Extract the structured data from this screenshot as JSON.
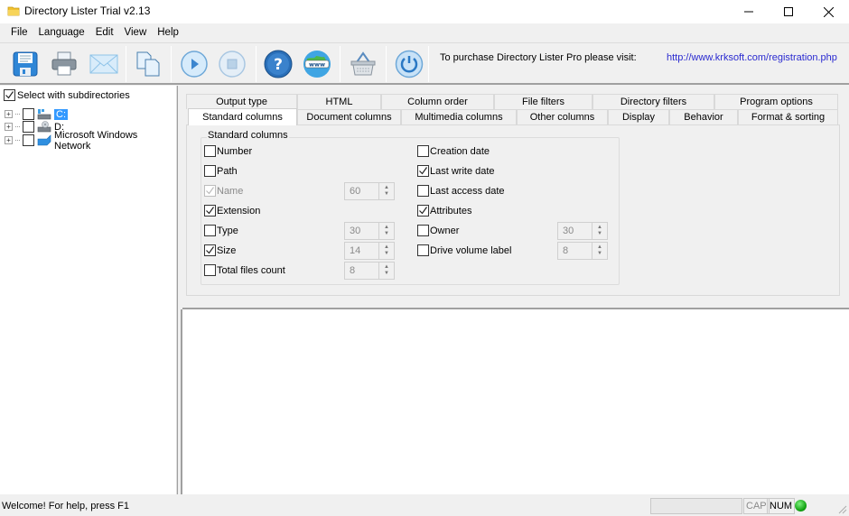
{
  "window": {
    "title": "Directory Lister Trial v2.13",
    "controls": {
      "minimize": "—",
      "maximize": "☐",
      "close": "✕"
    }
  },
  "menu": [
    "File",
    "Language",
    "Edit",
    "View",
    "Help"
  ],
  "toolbar": {
    "buttons": [
      {
        "name": "save",
        "icon": "floppy-disk-icon"
      },
      {
        "name": "print",
        "icon": "printer-icon"
      },
      {
        "name": "email",
        "icon": "envelope-icon"
      },
      {
        "name": "copy",
        "icon": "copy-documents-icon"
      },
      {
        "name": "start",
        "icon": "play-icon"
      },
      {
        "name": "stop",
        "icon": "stop-icon"
      },
      {
        "name": "help",
        "icon": "help-icon"
      },
      {
        "name": "website",
        "icon": "globe-www-icon"
      },
      {
        "name": "buy",
        "icon": "basket-icon"
      },
      {
        "name": "exit",
        "icon": "power-icon"
      }
    ],
    "purchase_text": "To purchase Directory Lister Pro please visit:",
    "purchase_link": "http://www.krksoft.com/registration.php"
  },
  "tree": {
    "select_subdirs_label": "Select with subdirectories",
    "select_subdirs_checked": true,
    "items": [
      {
        "label": "C:",
        "icon": "hard-drive-icon",
        "selected": true
      },
      {
        "label": "D:",
        "icon": "optical-drive-icon",
        "selected": false
      },
      {
        "label": "Microsoft Windows Network",
        "icon": "network-icon",
        "selected": false
      }
    ]
  },
  "tabs": {
    "row_back": [
      "Output type",
      "HTML",
      "Column order",
      "File filters",
      "Directory filters",
      "Program options"
    ],
    "row_front": [
      "Standard columns",
      "Document columns",
      "Multimedia columns",
      "Other columns",
      "Display",
      "Behavior",
      "Format & sorting"
    ],
    "active": "Standard columns"
  },
  "standard_columns": {
    "group_label": "Standard columns",
    "left": [
      {
        "label": "Number",
        "checked": false,
        "disabled": false,
        "width": null
      },
      {
        "label": "Path",
        "checked": false,
        "disabled": false,
        "width": null
      },
      {
        "label": "Name",
        "checked": true,
        "disabled": true,
        "width": "60"
      },
      {
        "label": "Extension",
        "checked": true,
        "disabled": false,
        "width": null
      },
      {
        "label": "Type",
        "checked": false,
        "disabled": false,
        "width": "30"
      },
      {
        "label": "Size",
        "checked": true,
        "disabled": false,
        "width": "14"
      },
      {
        "label": "Total files count",
        "checked": false,
        "disabled": false,
        "width": "8"
      }
    ],
    "right": [
      {
        "label": "Creation date",
        "checked": false,
        "width": null
      },
      {
        "label": "Last write date",
        "checked": true,
        "width": null
      },
      {
        "label": "Last access date",
        "checked": false,
        "width": null
      },
      {
        "label": "Attributes",
        "checked": true,
        "width": null
      },
      {
        "label": "Owner",
        "checked": false,
        "width": "30"
      },
      {
        "label": "Drive volume label",
        "checked": false,
        "width": "8"
      }
    ]
  },
  "statusbar": {
    "message": "Welcome! For help, press F1",
    "cap": "CAP",
    "num": "NUM",
    "led_color": "#10a010"
  }
}
